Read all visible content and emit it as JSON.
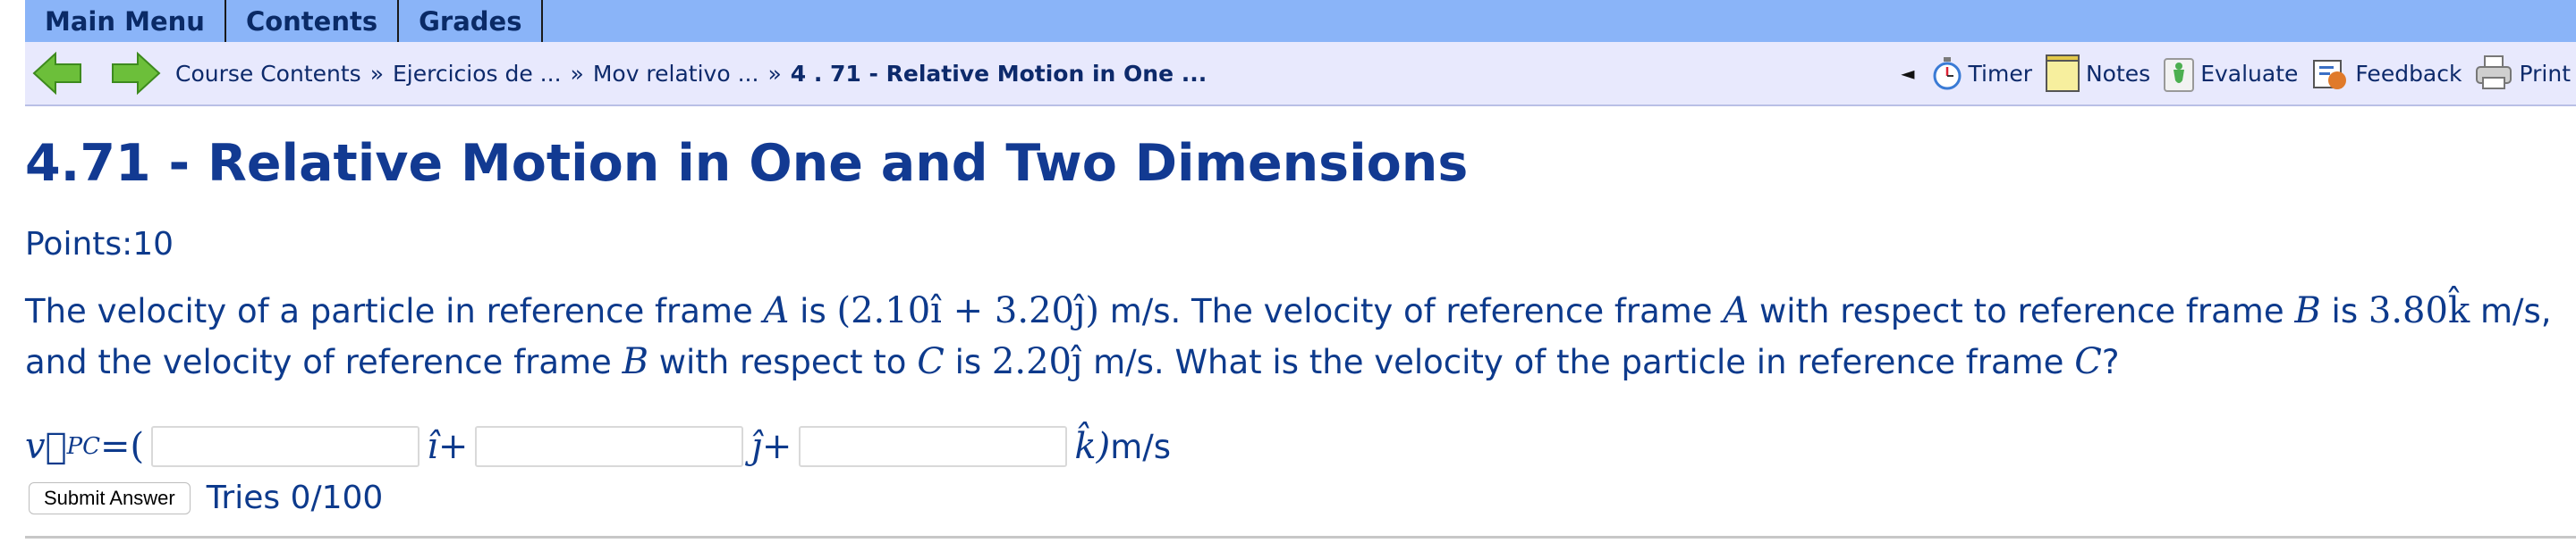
{
  "menu": {
    "items": [
      "Main Menu",
      "Contents",
      "Grades"
    ]
  },
  "nav": {
    "breadcrumbs": [
      "Course Contents",
      "Ejercicios de ...",
      "Mov relativo ...",
      "4 . 71 - Relative Motion in One ..."
    ],
    "separator": "»",
    "collapse_glyph": "◄",
    "tools": [
      {
        "label": "Timer",
        "icon": "stopwatch-icon"
      },
      {
        "label": "Notes",
        "icon": "note-pad-icon"
      },
      {
        "label": "Evaluate",
        "icon": "evaluate-icon"
      },
      {
        "label": "Feedback",
        "icon": "feedback-icon"
      },
      {
        "label": "Print",
        "icon": "printer-icon"
      }
    ]
  },
  "problem": {
    "title": "4.71 - Relative Motion in One and Two Dimensions",
    "points_label": "Points:",
    "points": "10",
    "question": {
      "p1": "The velocity of a particle in reference frame ",
      "m1": "A",
      "p2": " is ",
      "m2": "(2.10î + 3.20ĵ)",
      "p3": " m/s. The velocity of reference frame ",
      "m3": "A",
      "p4": " with respect to reference frame ",
      "m4": "B",
      "p5": " is ",
      "m5": "3.80k̂",
      "p6": " m/s, and the velocity of reference frame ",
      "m6": "B",
      "p7": " with respect to ",
      "m7": "C",
      "p8": " is ",
      "m8": "2.20ĵ",
      "p9": " m/s. What is the velocity of the particle in reference frame ",
      "m9": "C",
      "p10": "?"
    },
    "answer": {
      "lhs": "v⃗",
      "lhs_sub": "PC",
      "eq_open": " =(",
      "i_unit": "î+",
      "j_unit": "ĵ+",
      "k_unit": "k̂)",
      "units": " m/s",
      "values": [
        "",
        "",
        ""
      ]
    },
    "submit_label": "Submit Answer",
    "tries": "Tries 0/100"
  },
  "colors": {
    "menu_bg": "#8ab4f8",
    "nav_bg": "#e8e9fd",
    "text": "#0d3a8c",
    "title": "#123a92",
    "arrow_green": "#6cbf3a"
  }
}
